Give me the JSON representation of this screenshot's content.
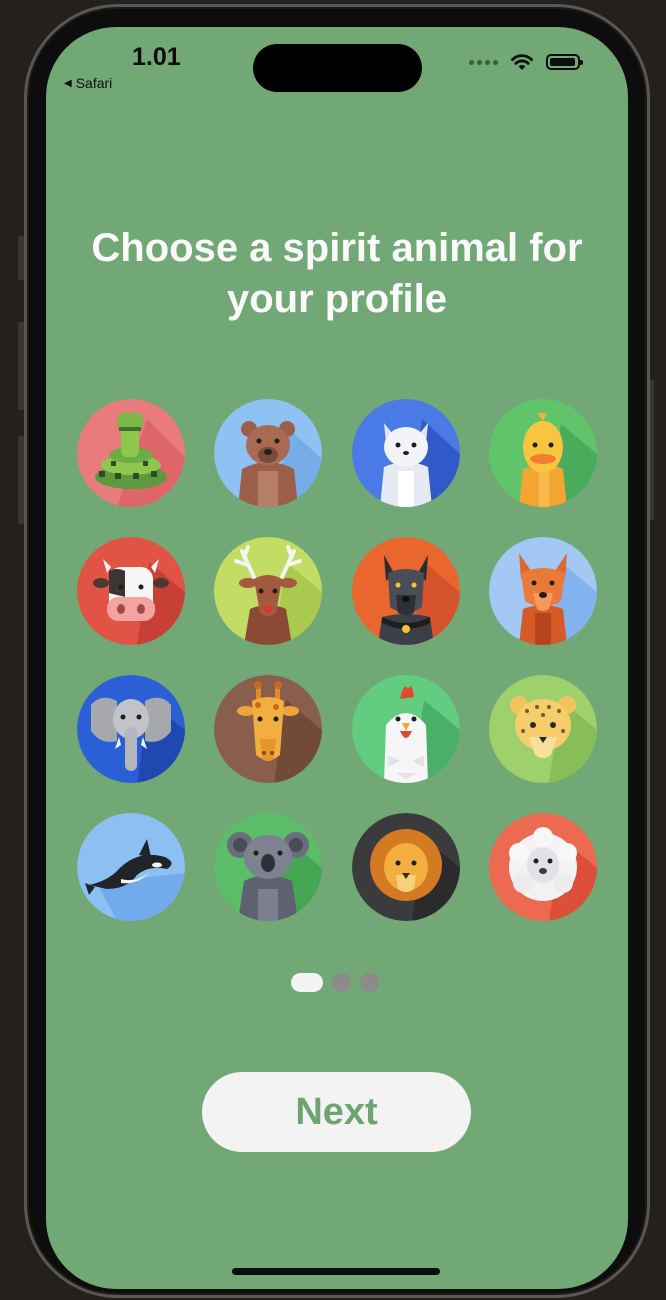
{
  "status_bar": {
    "time": "1.01",
    "back_app": "Safari",
    "wifi_icon": "wifi-icon",
    "battery_icon": "battery-icon"
  },
  "onboarding": {
    "title": "Choose a spirit animal for your profile",
    "animals": [
      {
        "name": "snake",
        "bg": "#ea7b7b"
      },
      {
        "name": "bear",
        "bg": "#8ec2f2"
      },
      {
        "name": "cat",
        "bg": "#4a7ae6"
      },
      {
        "name": "duck",
        "bg": "#5fc46a"
      },
      {
        "name": "cow",
        "bg": "#e05345"
      },
      {
        "name": "deer",
        "bg": "#c3dc63"
      },
      {
        "name": "dog",
        "bg": "#e9672f"
      },
      {
        "name": "fox",
        "bg": "#a3c8f4"
      },
      {
        "name": "elephant",
        "bg": "#2b5fd6"
      },
      {
        "name": "giraffe",
        "bg": "#8a5e4c"
      },
      {
        "name": "chicken",
        "bg": "#62cc80"
      },
      {
        "name": "leopard",
        "bg": "#9ed06b"
      },
      {
        "name": "orca",
        "bg": "#8cbff2"
      },
      {
        "name": "koala",
        "bg": "#5cbd68"
      },
      {
        "name": "lion",
        "bg": "#3b3b3d"
      },
      {
        "name": "sheep",
        "bg": "#ec6a52"
      }
    ],
    "page_indicator": {
      "pages": 3,
      "current": 1
    },
    "next_label": "Next"
  }
}
